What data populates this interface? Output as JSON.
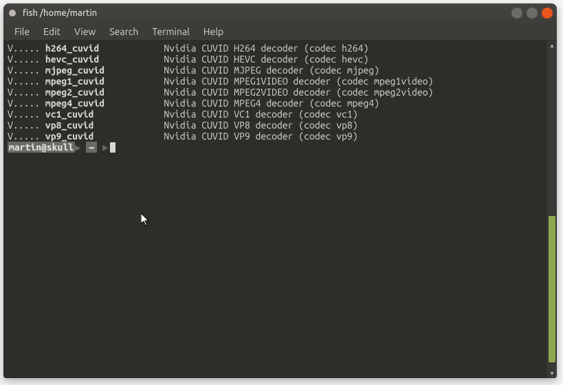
{
  "window": {
    "title": "fish  /home/martin"
  },
  "menu": {
    "items": [
      "File",
      "Edit",
      "View",
      "Search",
      "Terminal",
      "Help"
    ]
  },
  "terminal": {
    "codec_lines": [
      {
        "flags": "V..... ",
        "name": "h264_cuvid",
        "desc": "Nvidia CUVID H264 decoder (codec h264)"
      },
      {
        "flags": "V..... ",
        "name": "hevc_cuvid",
        "desc": "Nvidia CUVID HEVC decoder (codec hevc)"
      },
      {
        "flags": "V..... ",
        "name": "mjpeg_cuvid",
        "desc": "Nvidia CUVID MJPEG decoder (codec mjpeg)"
      },
      {
        "flags": "V..... ",
        "name": "mpeg1_cuvid",
        "desc": "Nvidia CUVID MPEG1VIDEO decoder (codec mpeg1video)"
      },
      {
        "flags": "V..... ",
        "name": "mpeg2_cuvid",
        "desc": "Nvidia CUVID MPEG2VIDEO decoder (codec mpeg2video)"
      },
      {
        "flags": "V..... ",
        "name": "mpeg4_cuvid",
        "desc": "Nvidia CUVID MPEG4 decoder (codec mpeg4)"
      },
      {
        "flags": "V..... ",
        "name": "vc1_cuvid",
        "desc": "Nvidia CUVID VC1 decoder (codec vc1)"
      },
      {
        "flags": "V..... ",
        "name": "vp8_cuvid",
        "desc": "Nvidia CUVID VP8 decoder (codec vp8)"
      },
      {
        "flags": "V..... ",
        "name": "vp9_cuvid",
        "desc": "Nvidia CUVID VP9 decoder (codec vp9)"
      }
    ],
    "name_column_width": 22,
    "prompt": {
      "user_host": "martin@skull",
      "path": "~"
    }
  }
}
